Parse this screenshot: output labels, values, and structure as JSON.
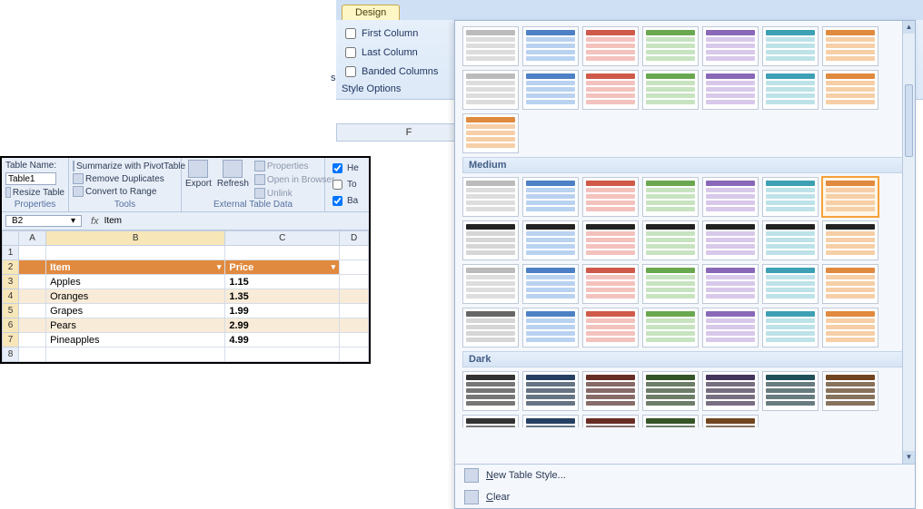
{
  "design": {
    "tab": "Design",
    "opts": {
      "first": "First Column",
      "last": "Last Column",
      "banded": "Banded Columns"
    },
    "caption": "Style Options",
    "cut_letter": "s"
  },
  "colF": "F",
  "inset": {
    "tableName": {
      "label": "Table Name:",
      "value": "Table1",
      "resize": "Resize Table",
      "caption": "Properties"
    },
    "tools": {
      "pivot": "Summarize with PivotTable",
      "dup": "Remove Duplicates",
      "range": "Convert to Range",
      "caption": "Tools"
    },
    "ext": {
      "export": "Export",
      "refresh": "Refresh",
      "props": "Properties",
      "browser": "Open in Browser",
      "unlink": "Unlink",
      "caption": "External Table Data"
    },
    "checks": {
      "he": "He",
      "to": "To",
      "ba": "Ba"
    },
    "ref": {
      "cell": "B2",
      "fx": "fx",
      "val": "Item"
    },
    "cols": [
      "A",
      "B",
      "C",
      "D"
    ],
    "rows": [
      "1",
      "2",
      "3",
      "4",
      "5",
      "6",
      "7",
      "8"
    ],
    "hdr": {
      "item": "Item",
      "price": "Price"
    },
    "data": [
      {
        "item": "Apples",
        "price": "1.15"
      },
      {
        "item": "Oranges",
        "price": "1.35"
      },
      {
        "item": "Grapes",
        "price": "1.99"
      },
      {
        "item": "Pears",
        "price": "2.99"
      },
      {
        "item": "Pineapples",
        "price": "4.99"
      }
    ]
  },
  "gallery": {
    "sect_medium": "Medium",
    "sect_dark": "Dark",
    "footer": {
      "new": "New Table Style...",
      "clear": "Clear"
    }
  }
}
